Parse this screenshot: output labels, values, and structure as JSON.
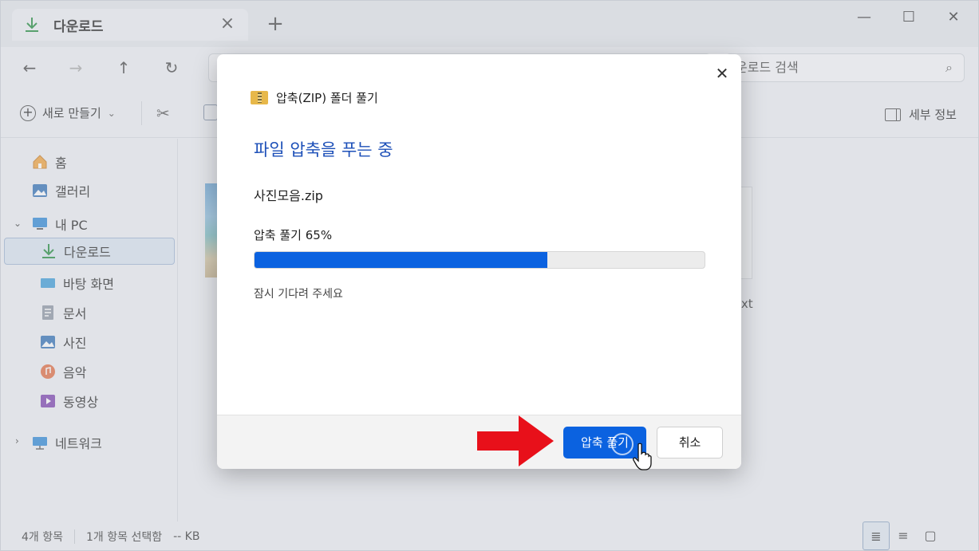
{
  "tab": {
    "title": "다운로드",
    "close_icon": "close-icon",
    "new_tab": "+"
  },
  "window_controls": {
    "minimize": "—",
    "maximize": "☐",
    "close": "✕"
  },
  "nav": {
    "back": "←",
    "forward": "→",
    "up": "↑",
    "refresh": "↻"
  },
  "search": {
    "placeholder": "운로드 검색",
    "icon": "search-icon"
  },
  "toolbar": {
    "new_label": "새로 만들기",
    "details_label": "세부 정보"
  },
  "sidebar": {
    "items": [
      {
        "label": "홈",
        "icon": "home-icon"
      },
      {
        "label": "갤러리",
        "icon": "gallery-icon"
      },
      {
        "label": "내 PC",
        "icon": "pc-icon"
      },
      {
        "label": "다운로드",
        "icon": "download-icon"
      },
      {
        "label": "바탕 화면",
        "icon": "desktop-icon"
      },
      {
        "label": "문서",
        "icon": "document-icon"
      },
      {
        "label": "사진",
        "icon": "pictures-icon"
      },
      {
        "label": "음악",
        "icon": "music-icon"
      },
      {
        "label": "동영상",
        "icon": "video-icon"
      },
      {
        "label": "네트워크",
        "icon": "network-icon"
      }
    ]
  },
  "content": {
    "partial_file_label": "txt"
  },
  "status": {
    "item_count": "4개 항목",
    "selected": "1개 항목 선택함",
    "size": "-- KB"
  },
  "dialog": {
    "title": "압축(ZIP) 폴더 풀기",
    "heading": "파일 압축을 푸는 중",
    "file_name": "사진모음.zip",
    "progress_label": "압축 풀기 65%",
    "progress_value": 0.65,
    "wait_message": "잠시 기다려 주세요",
    "extract_button": "압축 풀기",
    "cancel_button": "취소",
    "close_icon": "close-icon"
  },
  "colors": {
    "accent": "#0b62e0",
    "heading": "#1c4fb8",
    "arrow": "#e8101a",
    "download_icon": "#1e8a3a"
  }
}
